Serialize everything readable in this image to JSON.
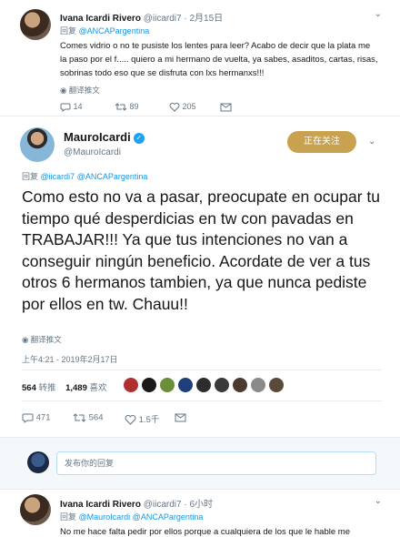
{
  "top_tweet": {
    "name": "Ivana Icardi Rivero",
    "handle": "@iicardi7",
    "date": "· 2月15日",
    "reply_prefix": "回复",
    "reply_to": "@ANCAPargentina",
    "text": "Comes vidrio o no te pusiste los lentes para leer? Acabo de decir que la plata me la paso por el f..... quiero a mi hermano de vuelta, ya sabes, asaditos, cartas, risas, sobrinas todo eso que se disfruta con lxs hermanxs!!!",
    "translate": "翻译推文",
    "replies": "14",
    "retweets": "89",
    "likes": "205"
  },
  "main_tweet": {
    "name": "MauroIcardi",
    "handle": "@MauroIcardi",
    "follow_label": "正在关注",
    "reply_prefix": "回复",
    "reply_to": "@iicardi7 @ANCAPargentina",
    "text": "Como esto no va a pasar, preocupate en ocupar tu tiempo qué desperdicias en tw con pavadas en TRABAJAR!!! Ya que tus intenciones no van a conseguir ningún beneficio. Acordate de ver a tus otros 6 hermanos tambien, ya que nunca pediste por ellos en tw. Chauu!!",
    "translate": "翻译推文",
    "timestamp": "上午4:21 - 2019年2月17日",
    "retweets_count": "564",
    "retweets_label": "转推",
    "likes_count": "1,489",
    "likes_label": "喜欢",
    "replies": "471",
    "retweets": "564",
    "likes": "1.5千"
  },
  "reply_box": {
    "placeholder": "发布你的回复"
  },
  "bottom_tweet": {
    "name": "Ivana Icardi Rivero",
    "handle": "@iicardi7",
    "date": "· 6小时",
    "reply_prefix": "回复",
    "reply_to": "@MauroIcardi @ANCAPargentina",
    "text": "No me hace falta pedir por ellos porque a cualquiera de los que le hable me"
  },
  "colors": {
    "link": "#1b95e0",
    "follow_button": "#c8a24e",
    "verified": "#1da1f2"
  }
}
